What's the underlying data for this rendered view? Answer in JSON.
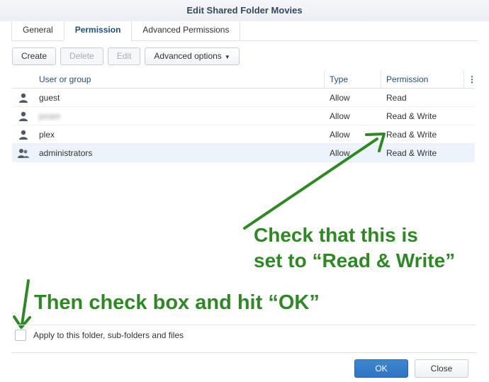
{
  "window": {
    "title": "Edit Shared Folder Movies"
  },
  "tabs": [
    {
      "label": "General"
    },
    {
      "label": "Permission"
    },
    {
      "label": "Advanced Permissions"
    }
  ],
  "toolbar": {
    "create_label": "Create",
    "delete_label": "Delete",
    "edit_label": "Edit",
    "advanced_label": "Advanced options"
  },
  "table": {
    "columns": {
      "user": "User or group",
      "type": "Type",
      "permission": "Permission",
      "more": "⋮"
    },
    "rows": [
      {
        "name": "guest",
        "type": "Allow",
        "permission": "Read",
        "icon": "user-icon"
      },
      {
        "name": "joram",
        "type": "Allow",
        "permission": "Read & Write",
        "icon": "user-icon",
        "blurred": true
      },
      {
        "name": "plex",
        "type": "Allow",
        "permission": "Read & Write",
        "icon": "user-icon"
      },
      {
        "name": "administrators",
        "type": "Allow",
        "permission": "Read & Write",
        "icon": "group-icon",
        "selected": true
      }
    ]
  },
  "annotations": {
    "check_line1": "Check that this is",
    "check_line2": "set to “Read & Write”",
    "then_check": "Then check box and hit “OK”"
  },
  "apply": {
    "label": "Apply to this folder, sub-folders and files",
    "checked": false
  },
  "footer": {
    "ok_label": "OK",
    "close_label": "Close"
  },
  "colors": {
    "accent": "#2f74c0",
    "annotation": "#2d8a22",
    "selected_row": "#edf3fb"
  }
}
